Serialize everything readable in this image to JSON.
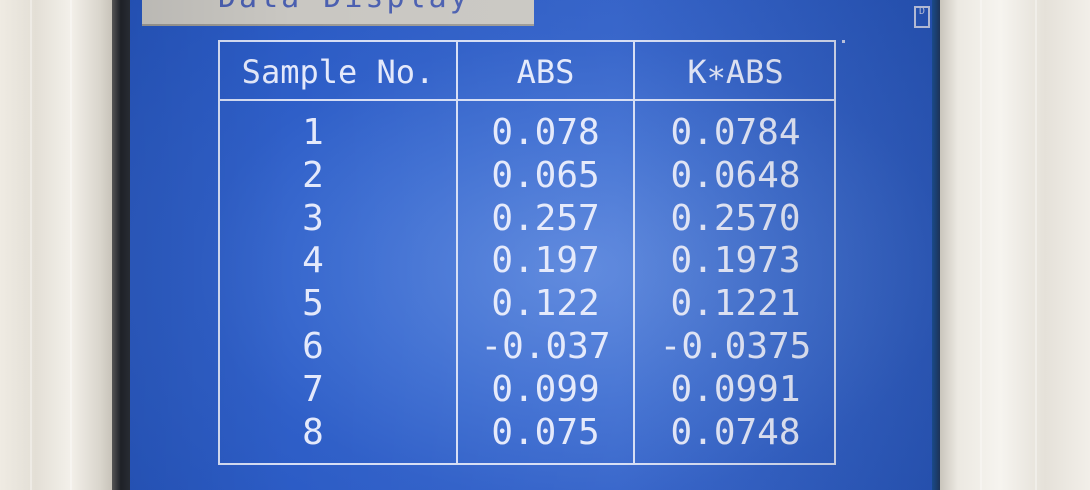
{
  "screen": {
    "title": "Data Display",
    "side_marker": "D"
  },
  "table": {
    "headers": {
      "sample": "Sample No.",
      "abs": "ABS",
      "kabs": "K∗ABS"
    },
    "rows": [
      {
        "sample": "1",
        "abs": "0.078",
        "kabs": "0.0784"
      },
      {
        "sample": "2",
        "abs": "0.065",
        "kabs": "0.0648"
      },
      {
        "sample": "3",
        "abs": "0.257",
        "kabs": "0.2570"
      },
      {
        "sample": "4",
        "abs": "0.197",
        "kabs": "0.1973"
      },
      {
        "sample": "5",
        "abs": "0.122",
        "kabs": "0.1221"
      },
      {
        "sample": "6",
        "abs": "-0.037",
        "kabs": "-0.0375"
      },
      {
        "sample": "7",
        "abs": "0.099",
        "kabs": "0.0991"
      },
      {
        "sample": "8",
        "abs": "0.075",
        "kabs": "0.0748"
      }
    ]
  },
  "colors": {
    "screen_background": "#2f5fc8",
    "text": "#e4e9fb",
    "title_bar": "#c9c7c2"
  }
}
